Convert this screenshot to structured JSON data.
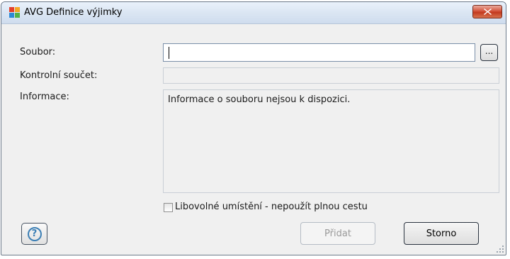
{
  "window": {
    "title": "AVG Definice výjimky",
    "icon": "avg-logo-icon",
    "close_icon": "close-icon"
  },
  "form": {
    "file_label": "Soubor:",
    "file_value": "",
    "browse_label": "...",
    "checksum_label": "Kontrolní součet:",
    "checksum_value": "",
    "info_label": "Informace:",
    "info_text": "Informace o souboru nejsou k dispozici.",
    "checkbox_label": "Libovolné umístění - nepoužít plnou cestu",
    "checkbox_checked": false
  },
  "buttons": {
    "help_icon": "help-icon",
    "add_label": "Přidat",
    "cancel_label": "Storno"
  },
  "colors": {
    "close_button": "#c23a1f",
    "help_icon": "#3c7fb5",
    "field_border": "#7a8fa8"
  }
}
